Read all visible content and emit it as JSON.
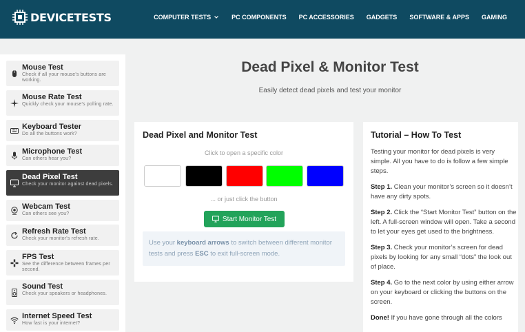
{
  "header": {
    "logo_text": "DEVICETESTS",
    "nav": [
      {
        "label": "COMPUTER TESTS",
        "has_dropdown": true
      },
      {
        "label": "PC COMPONENTS"
      },
      {
        "label": "PC ACCESSORIES"
      },
      {
        "label": "GADGETS"
      },
      {
        "label": "SOFTWARE & APPS"
      },
      {
        "label": "GAMING"
      }
    ]
  },
  "sidebar": {
    "items": [
      {
        "title": "Mouse Test",
        "desc": "Check if all your mouse's buttons are working.",
        "icon": "mouse-icon"
      },
      {
        "title": "Mouse Rate Test",
        "desc": "Quickly check your mouse's polling rate.",
        "icon": "cursor-move-icon"
      },
      {
        "title": "Keyboard Tester",
        "desc": "Do all the buttons work?",
        "icon": "keyboard-icon"
      },
      {
        "title": "Microphone Test",
        "desc": "Can others hear you?",
        "icon": "microphone-icon"
      },
      {
        "title": "Dead Pixel Test",
        "desc": "Check your monitor against dead pixels.",
        "icon": "monitor-icon",
        "active": true
      },
      {
        "title": "Webcam Test",
        "desc": "Can others see you?",
        "icon": "webcam-icon"
      },
      {
        "title": "Refresh Rate Test",
        "desc": "Check your monitor's refresh rate.",
        "icon": "refresh-icon"
      },
      {
        "title": "FPS Test",
        "desc": "See the difference between frames per second.",
        "icon": "gamepad-icon"
      },
      {
        "title": "Sound Test",
        "desc": "Check your speakers or headphones.",
        "icon": "speaker-icon"
      },
      {
        "title": "Internet Speed Test",
        "desc": "How fast is your internet?",
        "icon": "wifi-icon"
      }
    ]
  },
  "main": {
    "title": "Dead Pixel & Monitor Test",
    "subtitle": "Easily detect dead pixels and test your monitor"
  },
  "test_card": {
    "title": "Dead Pixel and Monitor Test",
    "click_hint": "Click to open a specific color",
    "swatches": [
      "#ffffff",
      "#000000",
      "#ff0000",
      "#00ff00",
      "#0000ff"
    ],
    "or_text": "... or just click the button",
    "start_label": "Start Monitor Test",
    "info_pre": "Use your ",
    "info_b1": "keyboard arrows",
    "info_mid": " to switch between different monitor tests and press ",
    "info_b2": "ESC",
    "info_post": " to exit full-screen mode."
  },
  "tutorial": {
    "title": "Tutorial – How To Test",
    "intro": "Testing your monitor for dead pixels is very simple. All you have to do is follow a few simple steps.",
    "steps": [
      {
        "label": "Step 1.",
        "text": " Clean your monitor’s screen so it doesn’t have any dirty spots."
      },
      {
        "label": "Step 2.",
        "text": " Click the “Start Monitor Test” button on the left. A full-screen window will open. Take a second to let your eyes get used to the brightness."
      },
      {
        "label": "Step 3.",
        "text": " Check your monitor’s screen for dead pixels by looking for any small “dots” the look out of place."
      },
      {
        "label": "Step 4.",
        "text": " Go to the next color by using either arrow on your keyboard or clicking the buttons on the screen."
      },
      {
        "label": "Done!",
        "text": " If you have gone through all the colors"
      }
    ]
  },
  "colors": {
    "header_bg": "#0f4a61",
    "accent_green": "#22a35a",
    "active_item_bg": "#3d3d3d"
  }
}
